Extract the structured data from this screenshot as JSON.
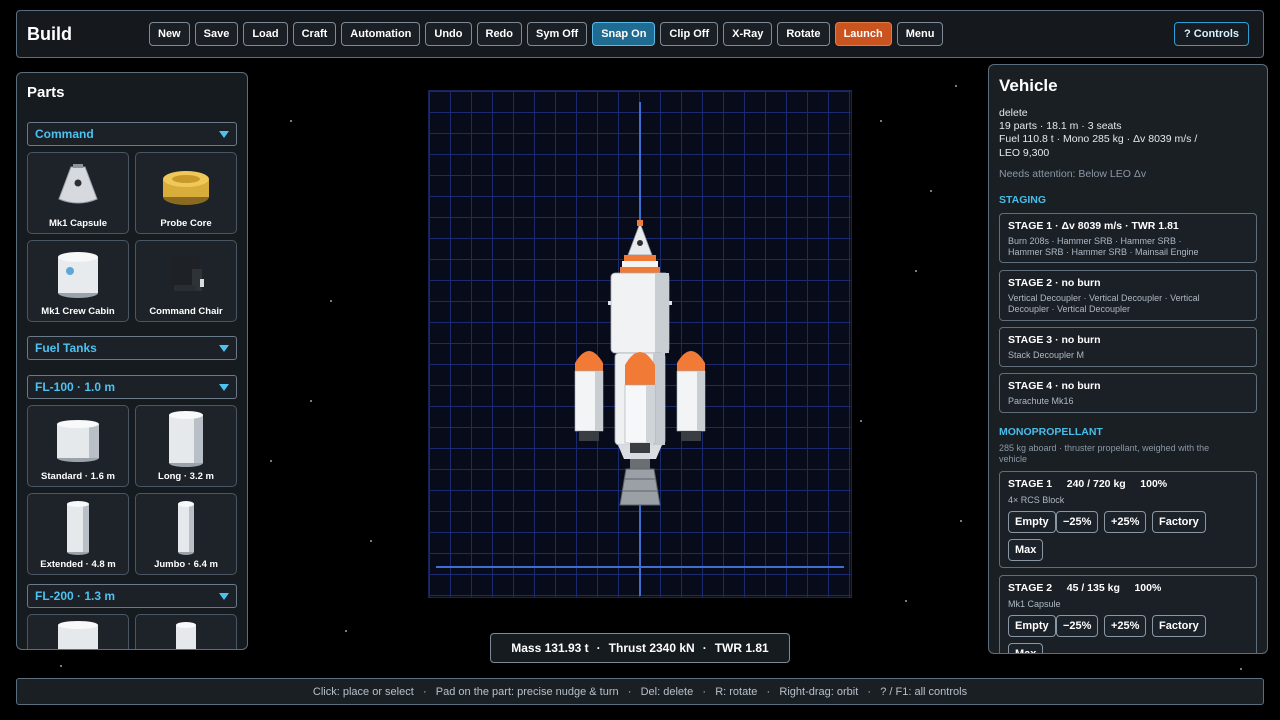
{
  "topbar": {
    "title": "Build",
    "buttons": [
      "New",
      "Save",
      "Load",
      "Craft",
      "Automation",
      "Undo",
      "Redo",
      "Sym Off",
      "Snap On",
      "Clip Off",
      "X-Ray",
      "Rotate",
      "Launch",
      "Menu"
    ],
    "controls_label": "? Controls"
  },
  "parts": {
    "title": "Parts",
    "category_command": "Command",
    "command_parts": [
      "Mk1 Capsule",
      "Probe Core",
      "Mk1 Crew Cabin",
      "Command Chair"
    ],
    "category_fuel": "Fuel Tanks",
    "fl100_label": "FL-100 · 1.0 m",
    "fl100_parts": [
      "Standard · 1.6 m",
      "Long · 3.2 m",
      "Extended · 4.8 m",
      "Jumbo · 6.4 m"
    ],
    "fl200_label": "FL-200 · 1.3 m"
  },
  "stats_bar": {
    "mass": "Mass 131.93 t",
    "thrust": "Thrust 2340 kN",
    "twr": "TWR 1.81",
    "sep": "·"
  },
  "vehicle": {
    "title": "Vehicle",
    "name": "delete",
    "summary1": "19 parts  ·  18.1 m  ·  3 seats",
    "summary2": "Fuel 110.8 t  ·  Mono 285 kg  ·  Δv 8039 m/s  /",
    "summary3": "LEO 9,300",
    "attention": "Needs attention: Below LEO Δv",
    "staging_title": "STAGING",
    "stages": [
      {
        "header": "STAGE 1  ·  Δv 8039 m/s  ·  TWR 1.81",
        "line1": "Burn 208s  ·  Hammer SRB  ·  Hammer SRB  ·",
        "line2": "Hammer SRB  ·  Hammer SRB  ·  Mainsail Engine"
      },
      {
        "header": "STAGE 2  ·  no burn",
        "line1": "Vertical Decoupler  ·  Vertical Decoupler  ·  Vertical",
        "line2": "Decoupler  ·  Vertical Decoupler"
      },
      {
        "header": "STAGE 3  ·  no burn",
        "line1": "Stack Decoupler M",
        "line2": ""
      },
      {
        "header": "STAGE 4  ·  no burn",
        "line1": "Parachute Mk16",
        "line2": ""
      }
    ],
    "mono_title": "MONOPROPELLANT",
    "mono_desc1": "285 kg aboard  ·  thruster propellant, weighed with the",
    "mono_desc2": "vehicle",
    "mono_stages": [
      {
        "header": "STAGE 1     240 / 720 kg     100%",
        "source": "4× RCS Block"
      },
      {
        "header": "STAGE 2     45 / 135 kg     100%",
        "source": "Mk1 Capsule"
      }
    ],
    "mono_buttons": [
      "Empty",
      "−25%",
      "+25%",
      "Factory",
      "Max"
    ]
  },
  "hints": {
    "text": "Click: place or select   ·   Pad on the part: precise nudge & turn   ·   Del: delete   ·   R: rotate   ·   Right-drag: orbit   ·   ? / F1: all controls"
  },
  "colors": {
    "accent": "#4cc2f0",
    "launch": "#c95420",
    "snap_active": "#1f6b92",
    "grid_line": "#1b2a6e",
    "axis": "#3f6ed0",
    "booster_nose": "#f07a36"
  },
  "icons": [
    "chevron-down-icon",
    "rocket-icon",
    "capsule-icon",
    "probe-core-icon",
    "crew-cabin-icon",
    "command-chair-icon",
    "fuel-tank-icon"
  ]
}
